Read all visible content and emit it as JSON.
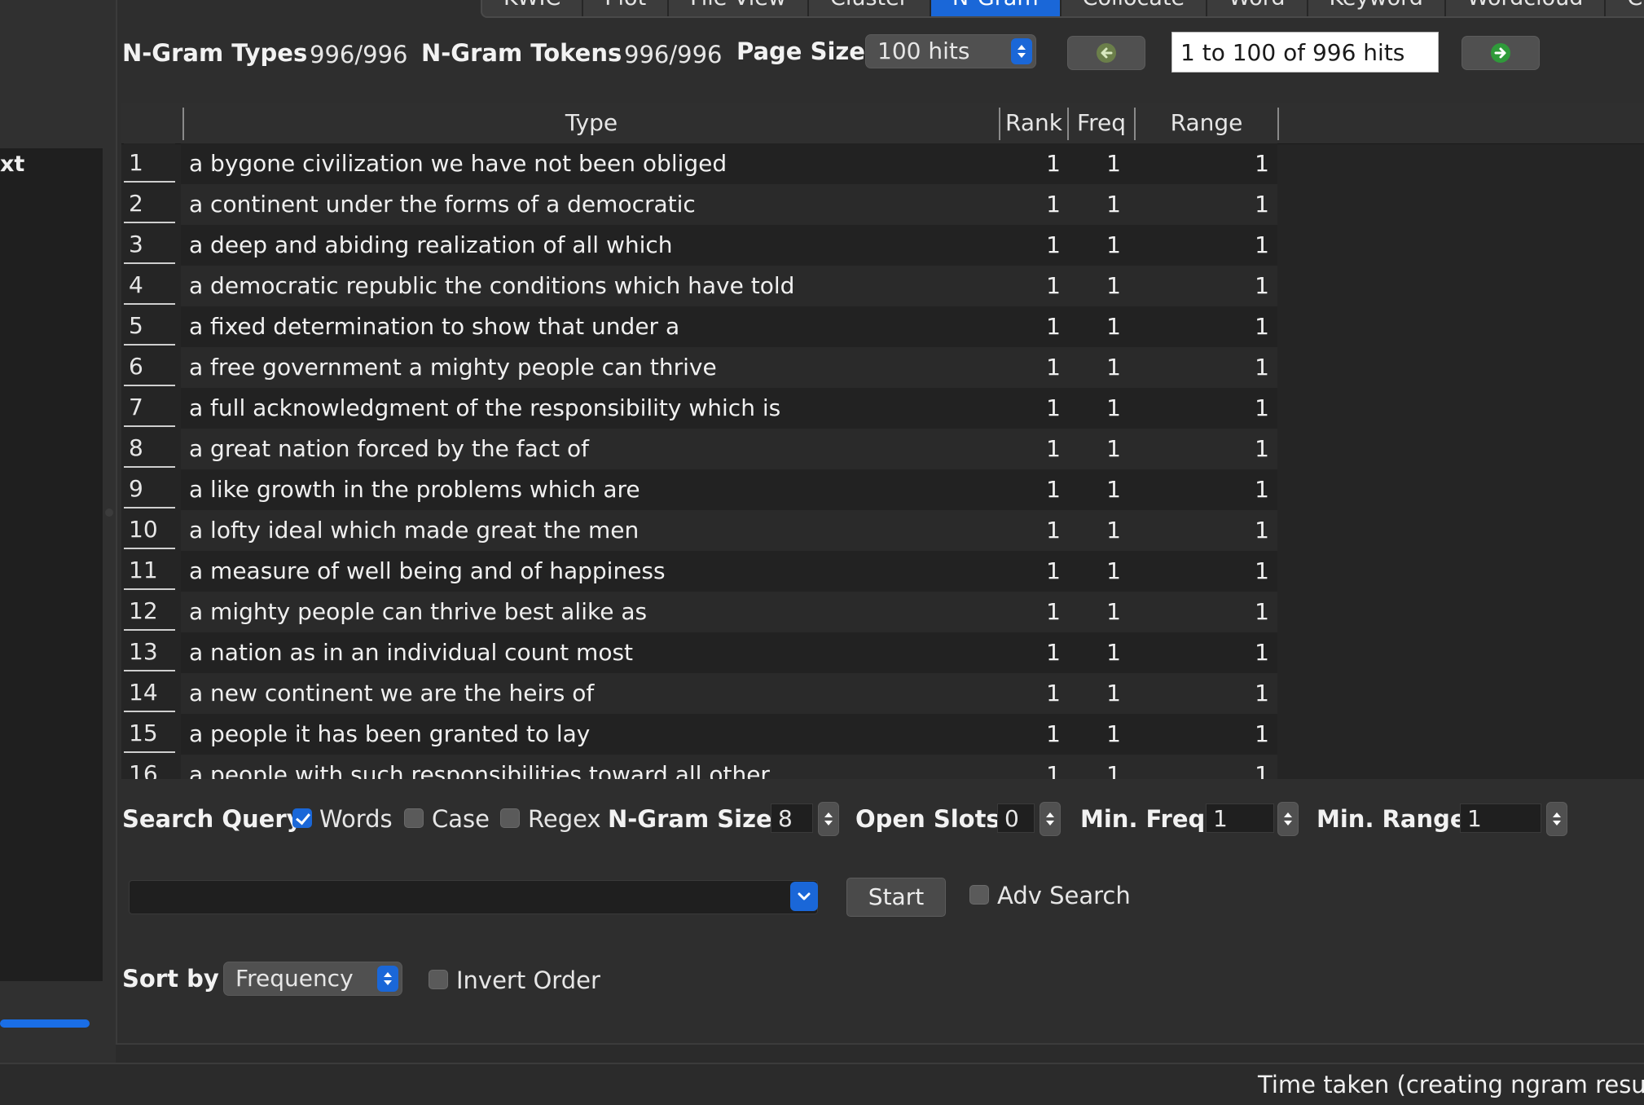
{
  "left_panel": {
    "list_text": "xt"
  },
  "tabs": [
    {
      "label": "KWIC",
      "active": false
    },
    {
      "label": "Plot",
      "active": false
    },
    {
      "label": "File View",
      "active": false
    },
    {
      "label": "Cluster",
      "active": false
    },
    {
      "label": "N-Gram",
      "active": true
    },
    {
      "label": "Collocate",
      "active": false
    },
    {
      "label": "Word",
      "active": false
    },
    {
      "label": "Keyword",
      "active": false
    },
    {
      "label": "Wordcloud",
      "active": false
    },
    {
      "label": "ChatAI",
      "active": false
    }
  ],
  "stats": {
    "types_label": "N-Gram Types",
    "types_value": "996/996",
    "tokens_label": "N-Gram Tokens",
    "tokens_value": "996/996",
    "page_size_label": "Page Size",
    "page_size_value": "100 hits",
    "hits_range": "1 to 100 of 996 hits"
  },
  "table": {
    "headers": {
      "type": "Type",
      "rank": "Rank",
      "freq": "Freq",
      "range": "Range"
    },
    "rows": [
      {
        "n": "1",
        "type": "a bygone civilization we have not been obliged",
        "rank": "1",
        "freq": "1",
        "range": "1"
      },
      {
        "n": "2",
        "type": "a continent under the forms of a democratic",
        "rank": "1",
        "freq": "1",
        "range": "1"
      },
      {
        "n": "3",
        "type": "a deep and abiding realization of all which",
        "rank": "1",
        "freq": "1",
        "range": "1"
      },
      {
        "n": "4",
        "type": "a democratic republic the conditions which have told",
        "rank": "1",
        "freq": "1",
        "range": "1"
      },
      {
        "n": "5",
        "type": "a fixed determination to show that under a",
        "rank": "1",
        "freq": "1",
        "range": "1"
      },
      {
        "n": "6",
        "type": "a free government a mighty people can thrive",
        "rank": "1",
        "freq": "1",
        "range": "1"
      },
      {
        "n": "7",
        "type": "a full acknowledgment of the responsibility which is",
        "rank": "1",
        "freq": "1",
        "range": "1"
      },
      {
        "n": "8",
        "type": "a great nation forced by the fact of",
        "rank": "1",
        "freq": "1",
        "range": "1"
      },
      {
        "n": "9",
        "type": "a like growth in the problems which are",
        "rank": "1",
        "freq": "1",
        "range": "1"
      },
      {
        "n": "10",
        "type": "a lofty ideal which made great the men",
        "rank": "1",
        "freq": "1",
        "range": "1"
      },
      {
        "n": "11",
        "type": "a measure of well being and of happiness",
        "rank": "1",
        "freq": "1",
        "range": "1"
      },
      {
        "n": "12",
        "type": "a mighty people can thrive best alike as",
        "rank": "1",
        "freq": "1",
        "range": "1"
      },
      {
        "n": "13",
        "type": "a nation as in an individual count most",
        "rank": "1",
        "freq": "1",
        "range": "1"
      },
      {
        "n": "14",
        "type": "a new continent we are the heirs of",
        "rank": "1",
        "freq": "1",
        "range": "1"
      },
      {
        "n": "15",
        "type": "a people it has been granted to lay",
        "rank": "1",
        "freq": "1",
        "range": "1"
      },
      {
        "n": "16",
        "type": "a people with such responsibilities toward all other",
        "rank": "1",
        "freq": "1",
        "range": "1"
      }
    ]
  },
  "search": {
    "query_label": "Search Query",
    "words_label": "Words",
    "words_checked": true,
    "case_label": "Case",
    "case_checked": false,
    "regex_label": "Regex",
    "regex_checked": false,
    "ngram_size_label": "N-Gram Size",
    "ngram_size_value": "8",
    "open_slots_label": "Open Slots",
    "open_slots_value": "0",
    "min_freq_label": "Min. Freq",
    "min_freq_value": "1",
    "min_range_label": "Min. Range",
    "min_range_value": "1",
    "query_value": "",
    "start_label": "Start",
    "adv_search_label": "Adv Search",
    "adv_search_checked": false
  },
  "sort": {
    "label": "Sort by",
    "value": "Frequency",
    "invert_label": "Invert Order",
    "invert_checked": false
  },
  "status": {
    "text": "Time taken (creating ngram results"
  },
  "colors": {
    "accent": "#1a67d8",
    "background": "#2b2b2b",
    "table_bg": "#222222"
  }
}
